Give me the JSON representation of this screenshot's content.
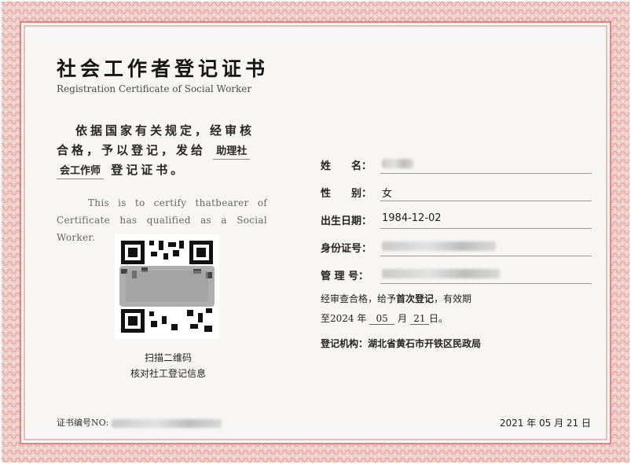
{
  "certificate": {
    "title": "社会工作者登记证书",
    "subtitle": "Registration Certificate of Social Worker",
    "cn_text": {
      "line1": "依据国家有关规定，经审核",
      "line2": "合格，予以登记，发给",
      "level_part1": "助理社",
      "level_part2": "会工作师",
      "line3_suffix": "登记证书。"
    },
    "en_text": "This is to certify thatbearer of Certificate has qualified as a Social Worker.",
    "qr_caption_line1": "扫描二维码",
    "qr_caption_line2": "核对社工登记信息",
    "serial_label": "证书编号NO:",
    "fields": [
      {
        "label": "姓　　名：",
        "value": ""
      },
      {
        "label": "性　　别：",
        "value": "女"
      },
      {
        "label": "出生日期：",
        "value": "1984-12-02"
      },
      {
        "label": "身份证号：",
        "value": ""
      },
      {
        "label": "管 理 号：",
        "value": ""
      }
    ],
    "validity": {
      "prefix": "经审查合格，给予",
      "emphasis": "首次登记",
      "suffix": "，有效期",
      "until_prefix": "至2024 年",
      "month": "05",
      "month_unit": "月",
      "day": "21",
      "day_unit": "日。"
    },
    "authority": {
      "label": "登记机构：",
      "value": "湖北省黄石市开铁区民政局"
    },
    "issue_date": "2021 年 05 月 21 日"
  },
  "colors": {
    "border_red": "#d97a72",
    "paper": "#f7f6f4"
  }
}
